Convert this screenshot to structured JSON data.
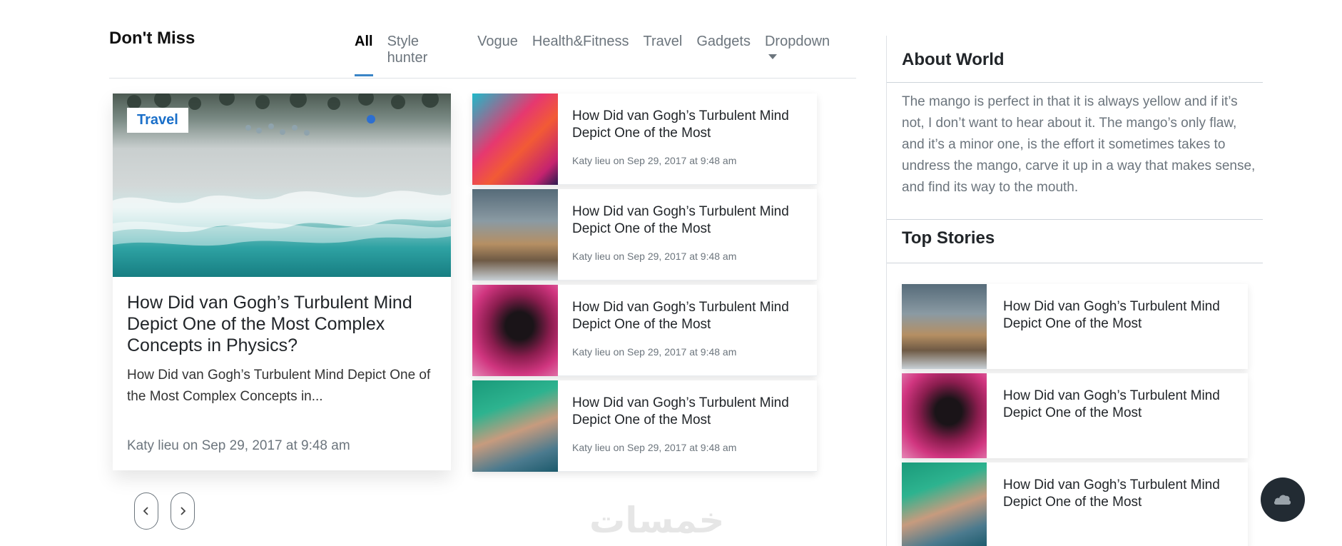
{
  "section": {
    "title": "Don't Miss"
  },
  "tabs": [
    {
      "label": "All",
      "active": true
    },
    {
      "label": "Style hunter"
    },
    {
      "label": "Vogue"
    },
    {
      "label": "Health&Fitness"
    },
    {
      "label": "Travel"
    },
    {
      "label": "Gadgets"
    },
    {
      "label": "Dropdown"
    }
  ],
  "featured": {
    "badge": "Travel",
    "title": "How Did van Gogh’s Turbulent Mind Depict One of the Most Complex Concepts in Physics?",
    "excerpt": "How Did van Gogh’s Turbulent Mind Depict One of the Most Complex Concepts in...",
    "meta": "Katy lieu on Sep 29, 2017 at 9:48 am"
  },
  "list": [
    {
      "title": "How Did van Gogh’s Turbulent Mind Depict One of the Most",
      "meta": "Katy lieu on Sep 29, 2017 at 9:48 am"
    },
    {
      "title": "How Did van Gogh’s Turbulent Mind Depict One of the Most",
      "meta": "Katy lieu on Sep 29, 2017 at 9:48 am"
    },
    {
      "title": "How Did van Gogh’s Turbulent Mind Depict One of the Most",
      "meta": "Katy lieu on Sep 29, 2017 at 9:48 am"
    },
    {
      "title": "How Did van Gogh’s Turbulent Mind Depict One of the Most",
      "meta": "Katy lieu on Sep 29, 2017 at 9:48 am"
    }
  ],
  "sidebar": {
    "about_title": "About World",
    "about_text": "The mango is perfect in that it is always yellow and if it’s not, I don’t want to hear about it. The mango’s only flaw, and it’s a minor one, is the effort it sometimes takes to undress the mango, carve it up in a way that makes sense, and find its way to the mouth.",
    "top_title": "Top Stories",
    "top_stories": [
      {
        "title": "How Did van Gogh’s Turbulent Mind Depict One of the Most"
      },
      {
        "title": "How Did van Gogh’s Turbulent Mind Depict One of the Most"
      },
      {
        "title": "How Did van Gogh’s Turbulent Mind Depict One of the Most"
      }
    ]
  },
  "watermark": "خمسات",
  "colors": {
    "accent": "#3a85c7",
    "badge_text": "#1a6fc9",
    "scroll_button": "#222b33"
  }
}
